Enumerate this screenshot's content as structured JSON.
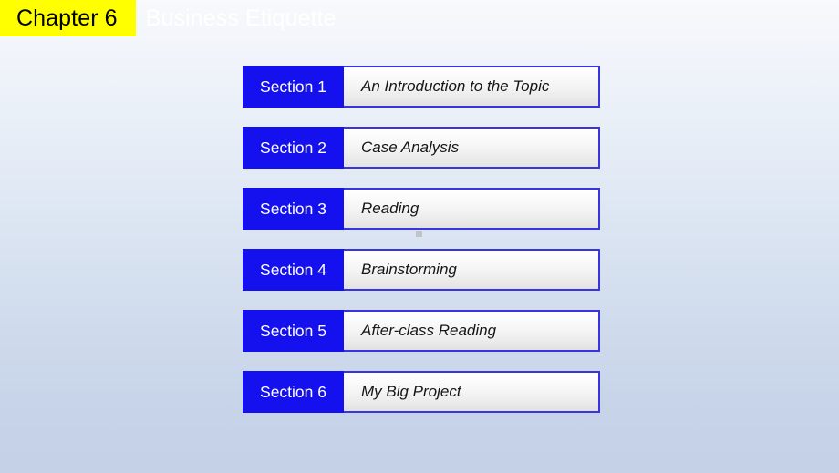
{
  "slide": {
    "background_top_color": "#f7f9fc",
    "background_bottom_color": "#c4d1e7"
  },
  "title": {
    "chapter_label": "Chapter 6",
    "chapter_chip_color": "#ffff00",
    "chapter_text_color": "#000000",
    "subject": "Business Etiquette",
    "subject_text_color": "#ffffff"
  },
  "accent": {
    "tag_blue": "#1410ee",
    "border_blue": "#3a34e0"
  },
  "sections": [
    {
      "tag": "Section 1",
      "title": "An Introduction to the Topic"
    },
    {
      "tag": "Section 2",
      "title": "Case Analysis"
    },
    {
      "tag": "Section 3",
      "title": "Reading"
    },
    {
      "tag": "Section 4",
      "title": "Brainstorming"
    },
    {
      "tag": "Section 5",
      "title": "After-class Reading"
    },
    {
      "tag": "Section 6",
      "title": "My Big Project"
    }
  ]
}
